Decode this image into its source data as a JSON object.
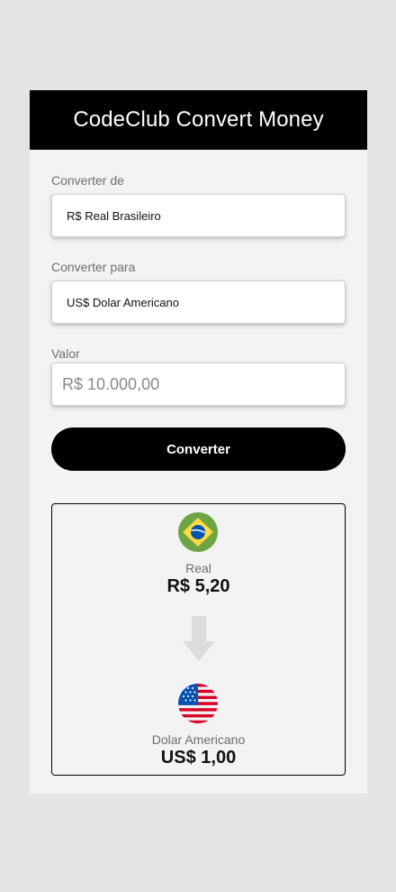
{
  "header": {
    "title": "CodeClub Convert Money"
  },
  "form": {
    "from_label": "Converter de",
    "from_value": "R$ Real Brasileiro",
    "to_label": "Converter para",
    "to_value": "US$ Dolar Americano",
    "amount_label": "Valor",
    "amount_placeholder": "R$ 10.000,00",
    "convert_button": "Converter"
  },
  "result": {
    "from": {
      "flag_icon": "brazil-flag-icon",
      "name": "Real",
      "value": "R$ 5,20"
    },
    "arrow_icon": "arrow-down-icon",
    "to": {
      "flag_icon": "usa-flag-icon",
      "name": "Dolar Americano",
      "value": "US$ 1,00"
    }
  },
  "colors": {
    "page_background": "#e4e4e4",
    "card_background": "#f3f3f3",
    "header_background": "#000000",
    "button_background": "#000000",
    "arrow": "#dcdcdc"
  }
}
